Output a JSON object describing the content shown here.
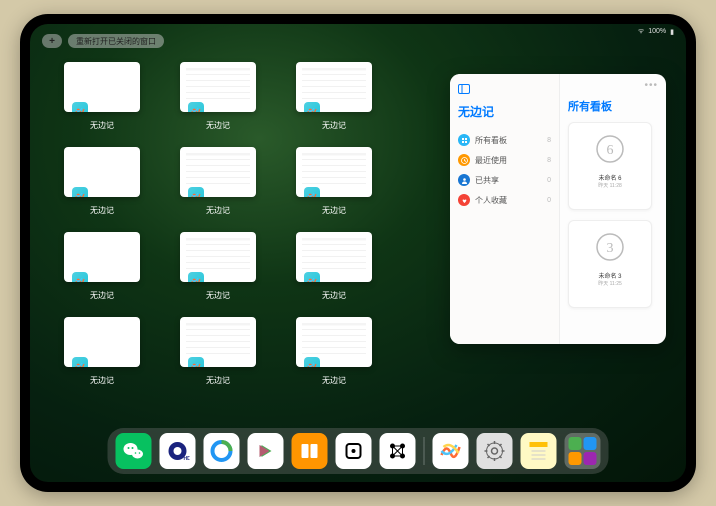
{
  "status": {
    "signal": "▂▃▅",
    "battery": "100%"
  },
  "topbar": {
    "plus": "+",
    "reopen_label": "重新打开已关闭的窗口"
  },
  "app_windows": {
    "label": "无边记",
    "items": [
      {
        "has_content": false
      },
      {
        "has_content": true
      },
      {
        "has_content": true
      },
      {
        "has_content": false
      },
      {
        "has_content": true
      },
      {
        "has_content": true
      },
      {
        "has_content": false
      },
      {
        "has_content": true
      },
      {
        "has_content": true
      },
      {
        "has_content": false
      },
      {
        "has_content": true
      },
      {
        "has_content": true
      }
    ]
  },
  "popover": {
    "left_title": "无边记",
    "right_title": "所有看板",
    "categories": [
      {
        "label": "所有看板",
        "count": 8,
        "color": "#29b6f6",
        "icon": "grid"
      },
      {
        "label": "最近使用",
        "count": 8,
        "color": "#ff9800",
        "icon": "clock"
      },
      {
        "label": "已共享",
        "count": 0,
        "color": "#1976d2",
        "icon": "person"
      },
      {
        "label": "个人收藏",
        "count": 0,
        "color": "#f44336",
        "icon": "heart"
      }
    ],
    "boards": [
      {
        "name": "未命名 6",
        "time": "昨天 11:28",
        "digit": "6"
      },
      {
        "name": "未命名 3",
        "time": "昨天 11:25",
        "digit": "3"
      }
    ]
  },
  "dock": {
    "apps": [
      {
        "name": "wechat",
        "bg": "#07c160"
      },
      {
        "name": "browser-hd",
        "bg": "#ffffff"
      },
      {
        "name": "qq-browser",
        "bg": "#ffffff"
      },
      {
        "name": "video-app",
        "bg": "#ffffff"
      },
      {
        "name": "books",
        "bg": "#ff9500"
      },
      {
        "name": "dice-app",
        "bg": "#ffffff"
      },
      {
        "name": "connect-app",
        "bg": "#ffffff"
      }
    ],
    "recent": [
      {
        "name": "freeform",
        "bg": "#ffffff"
      },
      {
        "name": "settings",
        "bg": "#e0e0e0"
      },
      {
        "name": "notes",
        "bg": "#fff9c4"
      }
    ]
  }
}
